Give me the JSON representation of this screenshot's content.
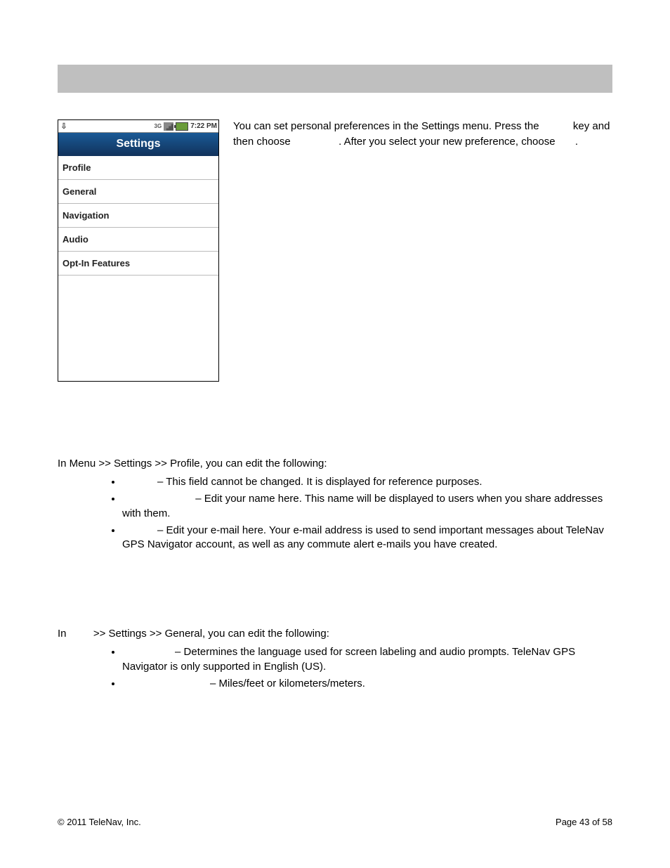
{
  "statusbar": {
    "time": "7:22 PM"
  },
  "settings_header": "Settings",
  "menu_items": [
    "Profile",
    "General",
    "Navigation",
    "Audio",
    "Opt-In Features"
  ],
  "intro": {
    "part1": "You can set personal preferences in the Settings menu. Press the ",
    "part2": " key and",
    "line2a": "then choose ",
    "line2b": ". After you select your new preference, choose ",
    "line2c": "."
  },
  "profile_section": {
    "intro": "In Menu >> Settings >> Profile, you can edit the following:",
    "items": [
      "– This field cannot be changed. It is displayed for reference purposes.",
      "– Edit your name here. This name will be displayed to users when you share addresses with them.",
      "– Edit your e-mail here. Your e-mail address is used to send important messages about TeleNav GPS Navigator account, as well as any commute alert e-mails you have created."
    ],
    "indents": [
      "            ",
      "                         ",
      "            "
    ]
  },
  "general_section": {
    "intro_a": "In ",
    "intro_b": " >> Settings >> General, you can edit the following:",
    "items": [
      "– Determines the language used for screen labeling and audio prompts. TeleNav GPS Navigator is only supported in English (US).",
      "– Miles/feet or kilometers/meters."
    ],
    "indents": [
      "                  ",
      "                              "
    ]
  },
  "footer": {
    "copyright": "© 2011 TeleNav, Inc.",
    "page": "Page 43 of 58"
  }
}
